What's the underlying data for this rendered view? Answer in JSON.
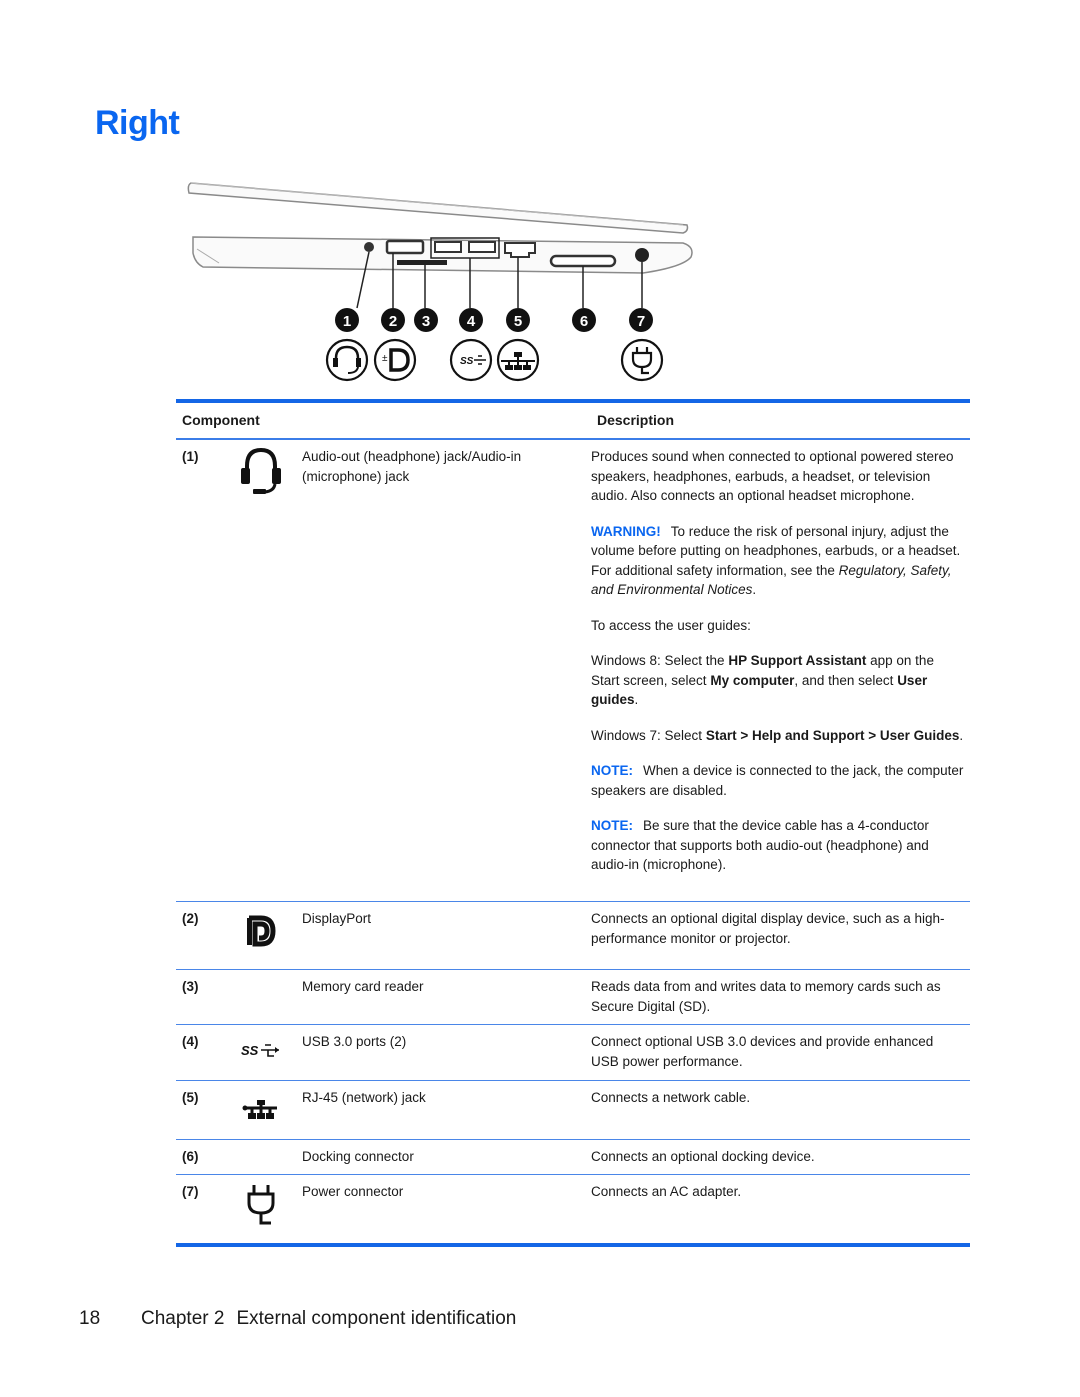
{
  "page": {
    "title": "Right",
    "accent_color": "#0a66f0"
  },
  "figure": {
    "callouts": [
      "1",
      "2",
      "3",
      "4",
      "5",
      "6",
      "7"
    ],
    "icons": [
      "headset-icon",
      "displayport-icon",
      "usb3-icon",
      "network-icon",
      "power-plug-icon"
    ]
  },
  "table": {
    "headers": {
      "component": "Component",
      "description": "Description"
    },
    "rows": [
      {
        "num": "(1)",
        "icon": "headset-icon",
        "name": "Audio-out (headphone) jack/Audio-in (microphone) jack",
        "desc": "Produces sound when connected to optional powered stereo speakers, headphones, earbuds, a headset, or television audio. Also connects an optional headset microphone.",
        "warning_label": "WARNING!",
        "warning_text": "To reduce the risk of personal injury, adjust the volume before putting on headphones, earbuds, or a headset. For additional safety information, see the",
        "warning_ref": "Regulatory, Safety, and Environmental Notices",
        "period": ".",
        "access": "To access the user guides:",
        "win8_a": "Windows 8: Select the",
        "win8_b1": "HP Support Assistant",
        "win8_c": "app on the Start screen, select",
        "win8_b2": "My computer",
        "win8_d": ", and then select",
        "win8_b3": "User guides",
        "win7_a": "Windows 7: Select",
        "win7_b": "Start > Help and Support > User Guides",
        "note1_label": "NOTE:",
        "note1_text": "When a device is connected to the jack, the computer speakers are disabled.",
        "note2_label": "NOTE:",
        "note2_text": "Be sure that the device cable has a 4-conductor connector that supports both audio-out (headphone) and audio-in (microphone)."
      },
      {
        "num": "(2)",
        "icon": "displayport-icon",
        "name": "DisplayPort",
        "desc": "Connects an optional digital display device, such as a high-performance monitor or projector."
      },
      {
        "num": "(3)",
        "icon": "",
        "name": "Memory card reader",
        "desc": "Reads data from and writes data to memory cards such as Secure Digital (SD)."
      },
      {
        "num": "(4)",
        "icon": "usb3-icon",
        "name": "USB 3.0 ports (2)",
        "desc": "Connect optional USB 3.0 devices and provide enhanced USB power performance."
      },
      {
        "num": "(5)",
        "icon": "network-icon",
        "name": "RJ-45 (network) jack",
        "desc": "Connects a network cable."
      },
      {
        "num": "(6)",
        "icon": "",
        "name": "Docking connector",
        "desc": "Connects an optional docking device."
      },
      {
        "num": "(7)",
        "icon": "power-plug-icon",
        "name": "Power connector",
        "desc": "Connects an AC adapter."
      }
    ]
  },
  "footer": {
    "page_number": "18",
    "chapter": "Chapter 2",
    "chapter_title": "External component identification"
  }
}
